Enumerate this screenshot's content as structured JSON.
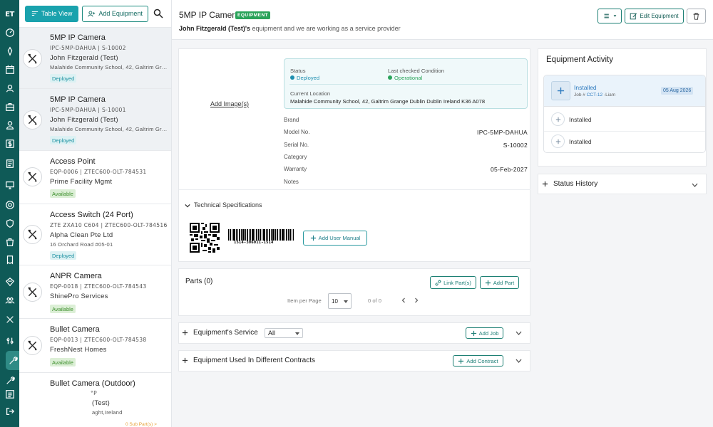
{
  "rail": {
    "logo": "ET",
    "icons": [
      "dashboard-icon",
      "pin-icon",
      "calendar-icon",
      "users-icon",
      "briefcase-icon",
      "user-icon",
      "dollar-icon",
      "document-icon",
      "cart-icon",
      "shield-icon",
      "bag-icon",
      "support-icon",
      "team-icon",
      "tools-icon",
      "equipment-icon",
      "wrench-icon",
      "list-icon",
      "logout-icon"
    ]
  },
  "toolbar": {
    "table_view_label": "Table View",
    "add_equipment_label": "Add Equipment"
  },
  "equipment_list": [
    {
      "name": "5MP IP Camera",
      "codes": "IPC-5MP-DAHUA  |  S-10002",
      "owner": "John Fitzgerald (Test)",
      "address": "Malahide Community School, 42, Galtrim Grange Dublin",
      "status": "Deployed",
      "selected": true
    },
    {
      "name": "5MP IP Camera",
      "codes": "IPC-5MP-DAHUA  |  S-10001",
      "owner": "John Fitzgerald (Test)",
      "address": "Malahide Community School, 42, Galtrim Grange Dublin",
      "status": "Deployed",
      "selected": true
    },
    {
      "name": "Access Point",
      "codes": "EQP-0006  |  ZTEC600-OLT-784531",
      "owner": "Prime Facility Mgmt",
      "address": "",
      "status": "Available"
    },
    {
      "name": "Access Switch (24 Port)",
      "codes": "ZTE ZXA10 C604  |  ZTEC600-OLT-784516",
      "owner": "Alpha Clean Pte Ltd",
      "address": "16 Orchard Road #05-01",
      "status": "Deployed"
    },
    {
      "name": "ANPR Camera",
      "codes": "EQP-0018  |  ZTEC600-OLT-784543",
      "owner": "ShinePro Services",
      "address": "",
      "status": "Available"
    },
    {
      "name": "Bullet Camera",
      "codes": "EQP-0013  |  ZTEC600-OLT-784538",
      "owner": "FreshNest Homes",
      "address": "",
      "status": "Available"
    },
    {
      "name": "Bullet Camera (Outdoor)",
      "codes": "°P",
      "owner": "(Test)",
      "address": "aght,Ireland",
      "status": "",
      "sub_parts": "0 Sub Part(s) >"
    }
  ],
  "header": {
    "title": "5MP IP Camera",
    "tag": "EQUIPMENT",
    "subtitle_owner": "John Fitzgerald (Test)'s",
    "subtitle_rest": " equipment and we are working as a service provider",
    "edit_label": "Edit Equipment"
  },
  "details": {
    "add_image_label": "Add Image(s)",
    "status_label": "Status",
    "status_value": "Deployed",
    "condition_label": "Last checked Condition",
    "condition_value": "Operational",
    "location_label": "Current Location",
    "location_value": "Malahide Community School, 42, Galtrim Grange Dublin Dublin Ireland K36 A078",
    "specs": [
      {
        "label": "Brand",
        "value": ""
      },
      {
        "label": "Model No.",
        "value": "IPC-5MP-DAHUA"
      },
      {
        "label": "Serial No.",
        "value": "S-10002"
      },
      {
        "label": "Category",
        "value": ""
      },
      {
        "label": "Warranty",
        "value": "05-Feb-2027"
      },
      {
        "label": "Notes",
        "value": ""
      }
    ],
    "tech_specs_label": "Technical Specifications",
    "barcode_number": "1514-306011-1514",
    "add_manual_label": "Add User Manual"
  },
  "parts": {
    "title": "Parts (0)",
    "link_label": "Link Part(s)",
    "add_label": "Add Part",
    "items_per_page_label": "Item per Page",
    "items_per_page_value": "10",
    "range_text": "0 of 0"
  },
  "service": {
    "title": "Equipment's Service",
    "filter_value": "All",
    "add_job_label": "Add Job"
  },
  "contracts": {
    "title": "Equipment Used In Different Contracts",
    "add_contract_label": "Add Contract"
  },
  "activity": {
    "title": "Equipment Activity",
    "items": [
      {
        "label": "Installed",
        "job_prefix": "Job # ",
        "job_code": "CCT-12",
        "job_suffix": " -Liam",
        "date": "05 Aug 2026"
      },
      {
        "label": "Installed"
      },
      {
        "label": "Installed"
      }
    ]
  },
  "status_history": {
    "title": "Status History"
  },
  "colors": {
    "rail": "#0f5a57",
    "accent": "#1aa2ad",
    "equipment_tag": "#2aa35a",
    "deployed": "#1a8fa0",
    "available": "#3e8f2e",
    "activity_blue": "#2f7bbf"
  }
}
